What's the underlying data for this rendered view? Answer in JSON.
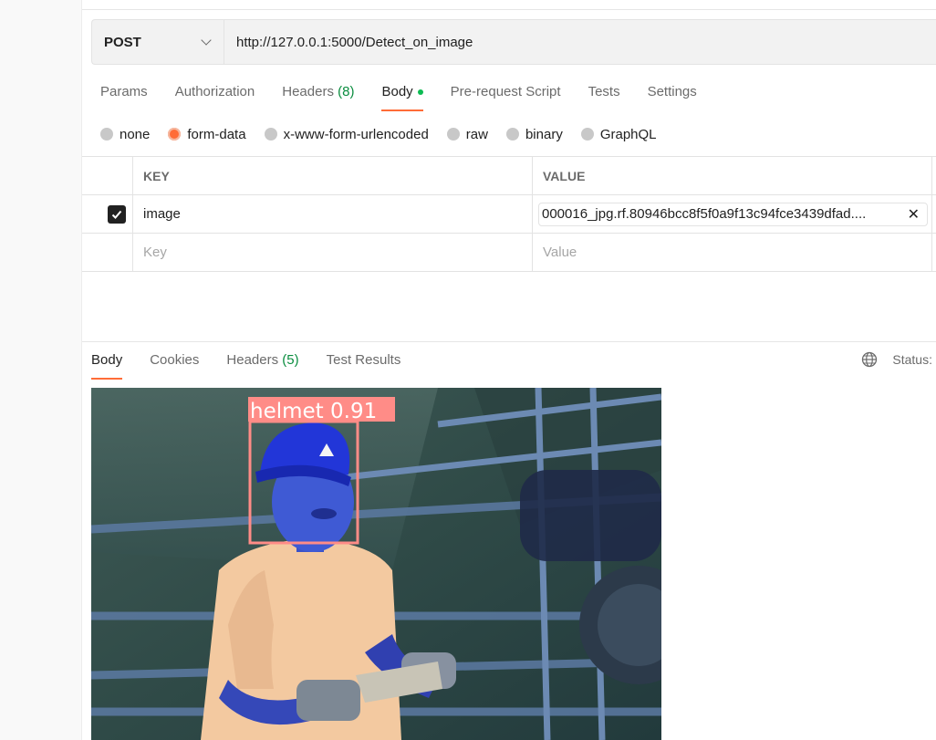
{
  "request": {
    "method": "POST",
    "url": "http://127.0.0.1:5000/Detect_on_image"
  },
  "request_tabs": [
    {
      "label": "Params"
    },
    {
      "label": "Authorization"
    },
    {
      "label": "Headers",
      "count": "(8)"
    },
    {
      "label": "Body"
    },
    {
      "label": "Pre-request Script"
    },
    {
      "label": "Tests"
    },
    {
      "label": "Settings"
    }
  ],
  "active_request_tab": "Body",
  "body_types": [
    "none",
    "form-data",
    "x-www-form-urlencoded",
    "raw",
    "binary",
    "GraphQL"
  ],
  "selected_body_type": "form-data",
  "form_table": {
    "headers": {
      "key": "KEY",
      "value": "VALUE"
    },
    "rows": [
      {
        "checked": true,
        "key": "image",
        "value": "000016_jpg.rf.80946bcc8f5f0a9f13c94fce3439dfad...."
      }
    ],
    "placeholder": {
      "key": "Key",
      "value": "Value"
    }
  },
  "response_tabs": [
    {
      "label": "Body"
    },
    {
      "label": "Cookies"
    },
    {
      "label": "Headers",
      "count": "(5)"
    },
    {
      "label": "Test Results"
    }
  ],
  "active_response_tab": "Body",
  "status_label": "Status:",
  "detection": {
    "label": "helmet 0.91",
    "color": "#ff8c87"
  },
  "colors": {
    "accent": "#ff6c37",
    "count_green": "#0a8d3f",
    "dot_green": "#0cbb52"
  }
}
